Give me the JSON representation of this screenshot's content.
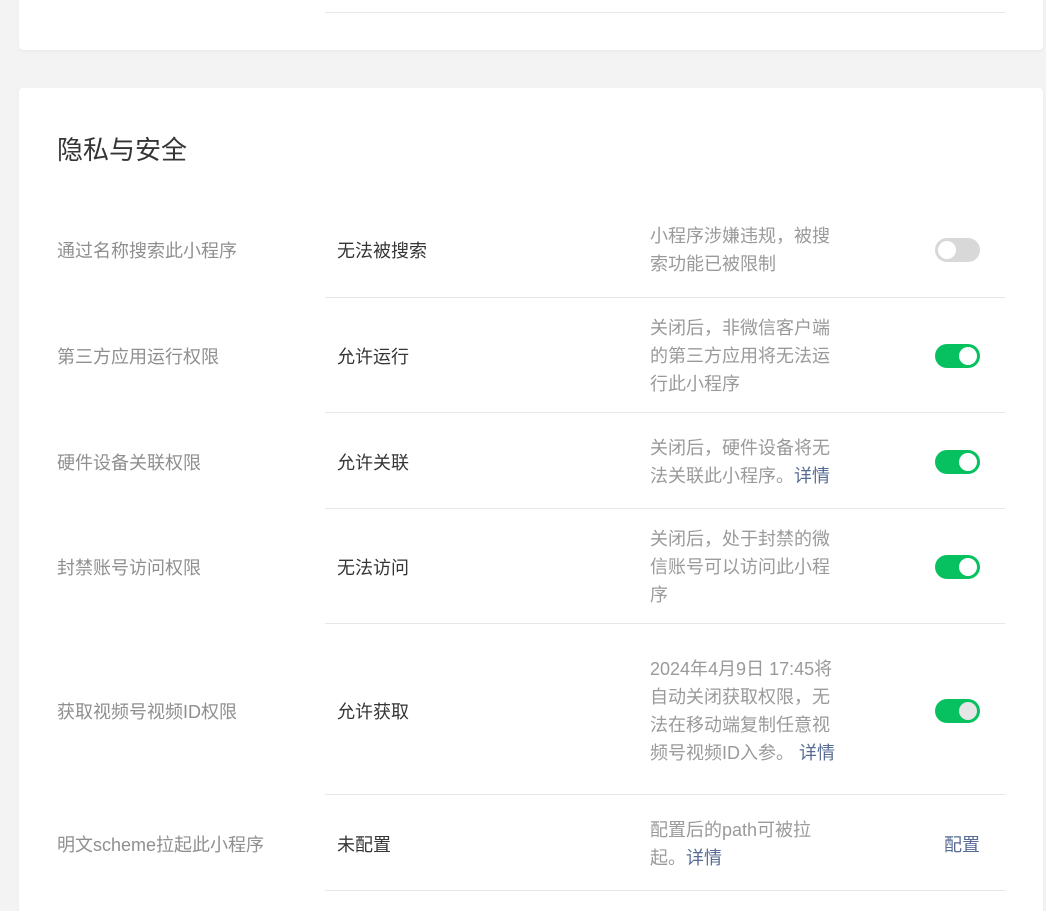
{
  "section": {
    "title": "隐私与安全"
  },
  "rows": [
    {
      "label": "通过名称搜索此小程序",
      "value": "无法被搜索",
      "desc": "小程序涉嫌违规，被搜索功能已被限制",
      "switch": "off"
    },
    {
      "label": "第三方应用运行权限",
      "value": "允许运行",
      "desc": "关闭后，非微信客户端的第三方应用将无法运行此小程序",
      "switch": "on"
    },
    {
      "label": "硬件设备关联权限",
      "value": "允许关联",
      "desc": "关闭后，硬件设备将无法关联此小程序。",
      "desc_link": "详情",
      "switch": "on"
    },
    {
      "label": "封禁账号访问权限",
      "value": "无法访问",
      "desc": "关闭后，处于封禁的微信账号可以访问此小程序",
      "switch": "on"
    },
    {
      "label": "获取视频号视频ID权限",
      "value": "允许获取",
      "desc": "2024年4月9日 17:45将自动关闭获取权限，无法在移动端复制任意视频号视频ID入参。",
      "desc_link": " 详情",
      "switch": "on"
    },
    {
      "label": "明文scheme拉起此小程序",
      "value": "未配置",
      "desc": "配置后的path可被拉起。",
      "desc_link": "详情",
      "action": "配置"
    }
  ],
  "colors": {
    "switch_on": "#07c160",
    "switch_off": "#d8d8d8",
    "link": "#576b95"
  },
  "icons": [
    "toggle-switch"
  ]
}
